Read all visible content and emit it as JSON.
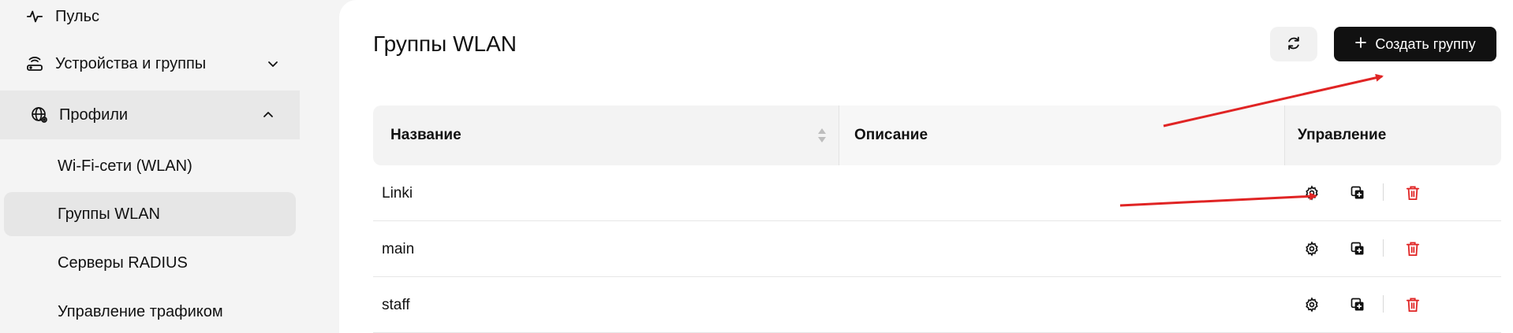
{
  "sidebar": {
    "items": [
      {
        "label": "Пульс",
        "icon": "pulse-icon"
      },
      {
        "label": "Устройства и группы",
        "icon": "router-icon"
      },
      {
        "label": "Профили",
        "icon": "globe-gear-icon"
      }
    ],
    "sub_items": [
      {
        "label": "Wi-Fi-сети (WLAN)"
      },
      {
        "label": "Группы WLAN"
      },
      {
        "label": "Серверы RADIUS"
      },
      {
        "label": "Управление трафиком"
      }
    ]
  },
  "main": {
    "title": "Группы WLAN",
    "create_label": "Создать группу",
    "table": {
      "columns": [
        "Название",
        "Описание",
        "Управление"
      ],
      "rows": [
        {
          "name": "Linki",
          "description": ""
        },
        {
          "name": "main",
          "description": ""
        },
        {
          "name": "staff",
          "description": ""
        }
      ]
    }
  },
  "colors": {
    "accent": "#111111",
    "danger": "#e02424",
    "annotation_arrow": "#e02424"
  }
}
